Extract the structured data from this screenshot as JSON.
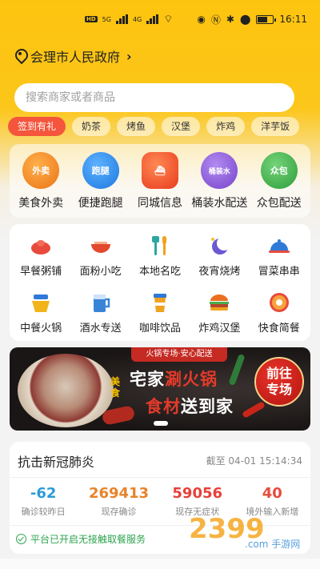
{
  "status_bar": {
    "time": "16:11",
    "network": "5G",
    "network2": "4G",
    "hd": "HD"
  },
  "location": {
    "city": "会理市人民政府"
  },
  "search": {
    "placeholder": "搜索商家或者商品"
  },
  "tags": [
    "签到有礼",
    "奶茶",
    "烤鱼",
    "汉堡",
    "炸鸡",
    "洋芋饭"
  ],
  "main_services": [
    {
      "label": "美食外卖",
      "icon_text": "外卖",
      "color": "#f08a2a",
      "icon": "takeaway-icon"
    },
    {
      "label": "便捷跑腿",
      "icon_text": "跑腿",
      "color": "#2d8ff0",
      "icon": "runner-icon"
    },
    {
      "label": "同城信息",
      "icon_text": "",
      "color": "#f0542e",
      "icon": "ship-icon"
    },
    {
      "label": "桶装水配送",
      "icon_text": "桶装水",
      "color": "#8b5bd8",
      "icon": "water-bucket-icon"
    },
    {
      "label": "众包配送",
      "icon_text": "众包",
      "color": "#3fb34a",
      "icon": "crowd-delivery-icon"
    }
  ],
  "categories": [
    {
      "label": "早餐粥铺",
      "icon": "bun-icon",
      "color": "#e84a3c"
    },
    {
      "label": "面粉小吃",
      "icon": "noodle-bowl-icon",
      "color": "#e2492d"
    },
    {
      "label": "本地名吃",
      "icon": "fork-spoon-icon",
      "color": "#2aa7a0"
    },
    {
      "label": "夜宵烧烤",
      "icon": "moon-icon",
      "color": "#6b58d4"
    },
    {
      "label": "冒菜串串",
      "icon": "cloche-icon",
      "color": "#2f79d8"
    },
    {
      "label": "中餐火锅",
      "icon": "hotpot-icon",
      "color": "#f2b41a"
    },
    {
      "label": "酒水专送",
      "icon": "beer-icon",
      "color": "#3a84d8"
    },
    {
      "label": "咖啡饮品",
      "icon": "coffee-cup-icon",
      "color": "#f0a21e"
    },
    {
      "label": "炸鸡汉堡",
      "icon": "burger-icon",
      "color": "#e8701f"
    },
    {
      "label": "快食简餐",
      "icon": "donut-icon",
      "color": "#e84a3c"
    }
  ],
  "banner": {
    "top_tag": "火锅专场·安心配送",
    "side_text": "美食",
    "line1_a": "宅家",
    "line1_b": "涮火锅",
    "line2_a": "食材",
    "line2_b": "送到家",
    "button_line1": "前往",
    "button_line2": "专场"
  },
  "covid": {
    "title": "抗击新冠肺炎",
    "updated": "截至 04-01 15:14:34",
    "stats": [
      {
        "value": "-62",
        "caption": "确诊较昨日",
        "color": "#2b9bd8"
      },
      {
        "value": "269413",
        "caption": "现存确诊",
        "color": "#e8832a"
      },
      {
        "value": "59056",
        "caption": "现存无症状",
        "color": "#e8403a"
      },
      {
        "value": "40",
        "caption": "境外输入新增",
        "color": "#e84a3c"
      }
    ],
    "footer": "平台已开启无接触取餐服务"
  },
  "watermark": {
    "text": "2399",
    "sub": ".com 手游网"
  }
}
